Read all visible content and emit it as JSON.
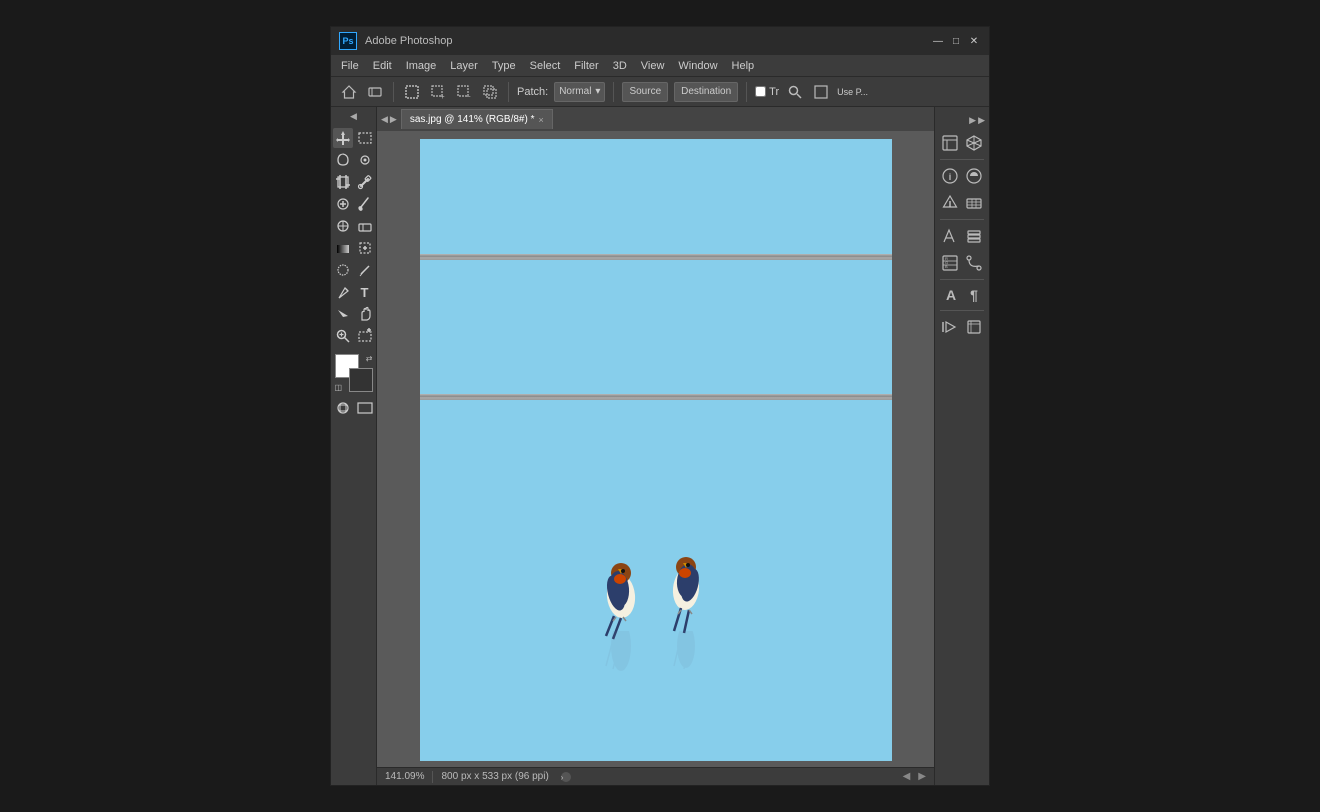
{
  "window": {
    "title": "Adobe Photoshop",
    "ps_label": "Ps"
  },
  "title_bar": {
    "controls": [
      "—",
      "□",
      "✕"
    ]
  },
  "menu_bar": {
    "items": [
      "File",
      "Edit",
      "Image",
      "Layer",
      "Type",
      "Select",
      "Filter",
      "3D",
      "View",
      "Window",
      "Help"
    ]
  },
  "options_bar": {
    "patch_label": "Patch:",
    "mode_value": "Normal",
    "source_label": "Source",
    "destination_label": "Destination",
    "transparent_label": "Tr",
    "use_pattern_label": "Use P..."
  },
  "tab": {
    "title": "sas.jpg @ 141% (RGB/8#) *",
    "close": "×"
  },
  "status_bar": {
    "zoom": "141.09%",
    "dimensions": "800 px x 533 px (96 ppi)",
    "arrow": "›"
  },
  "tools": {
    "move": "✛",
    "rect_select": "⬜",
    "lasso": "⚯",
    "magic_wand": "◎",
    "crop": "⊞",
    "eyedropper": "𝒊",
    "healing": "✚",
    "brush": "/",
    "clone": "⊙",
    "eraser": "◫",
    "gradient": "■",
    "smudge": "☞",
    "dodge": "○",
    "pen": "✒",
    "text": "T",
    "path_select": "▶",
    "shape": "□",
    "hand": "✋",
    "zoom": "🔍",
    "marquee": "⬚"
  },
  "right_panel": {
    "icons": [
      "⊞",
      "✳",
      "ℹ",
      "◑",
      "⚙",
      "⬡",
      "✎",
      "⊡",
      "▤",
      "⊛",
      "A",
      "¶",
      "✂",
      "⊟"
    ]
  },
  "colors": {
    "sky_blue": "#87CEEB",
    "wire_color": "#999999",
    "bg_app": "#3c3c3c",
    "toolbar_bg": "#3c3c3c",
    "canvas_bg": "#5a5a5a",
    "dark_bg": "#2b2b2b"
  }
}
